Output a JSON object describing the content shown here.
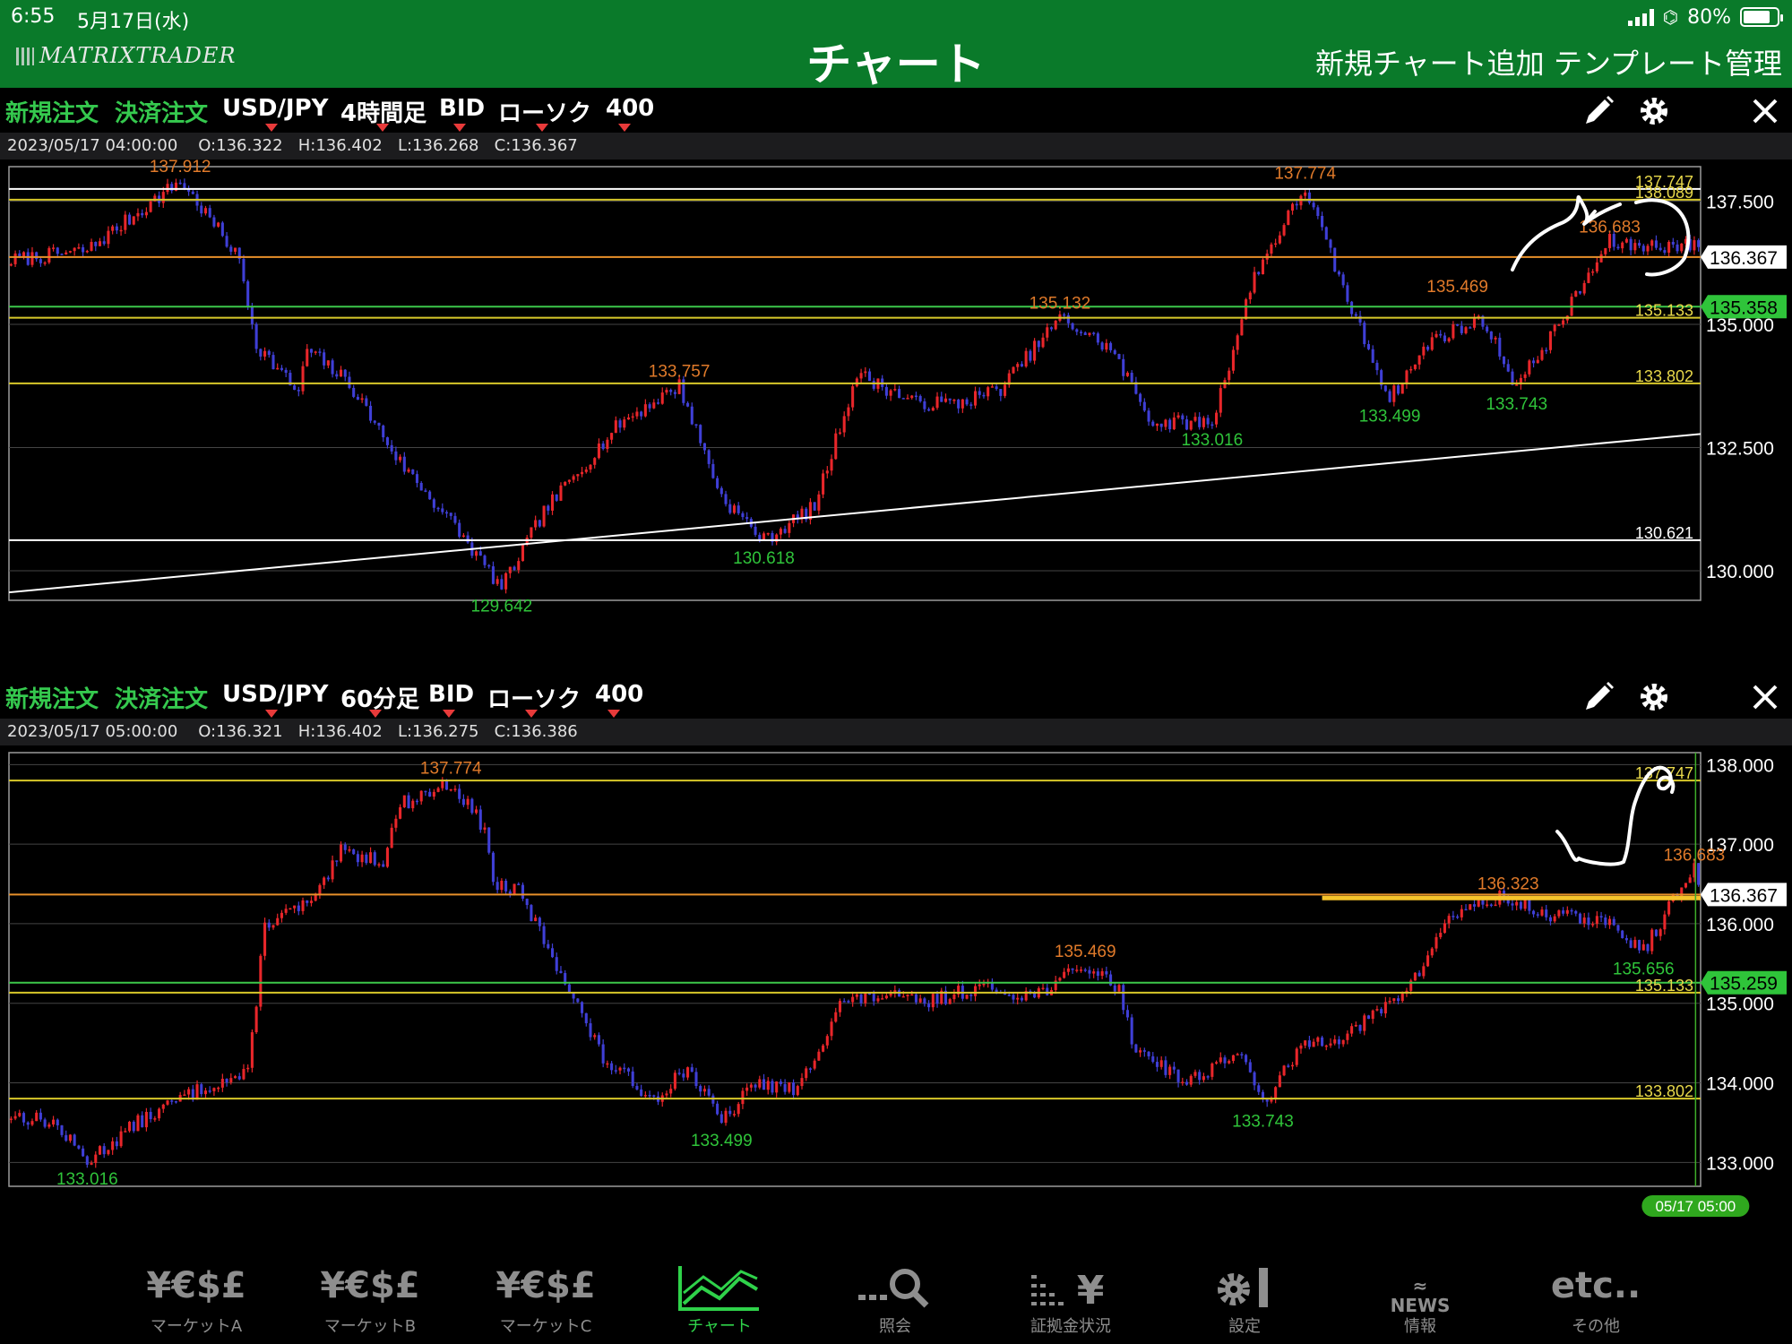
{
  "status": {
    "time": "6:55",
    "date": "5月17日(水)",
    "battery": "80%",
    "battery_level": 0.8
  },
  "header": {
    "logo": "MATRIXTRADER",
    "title": "チャート",
    "add_chart": "新規チャート追加",
    "template_mgmt": "テンプレート管理"
  },
  "colors": {
    "header_green": "#0a7a2a",
    "bull": "#e8262a",
    "bear": "#3f3fd6",
    "tab_active": "#2fd24a",
    "line_yellow": "#d8c82a",
    "line_orange": "#e8902a",
    "line_green": "#3cc84a",
    "label_orange": "#e07a2a",
    "label_green": "#2fc43a"
  },
  "panels": [
    {
      "toolbar": {
        "new_order": "新規注文",
        "close_order": "決済注文",
        "symbol": "USD/JPY",
        "timeframe": "4時間足",
        "price_type": "BID",
        "chart_type": "ローソク",
        "bars": "400"
      },
      "ohlc": {
        "datetime": "2023/05/17 04:00:00",
        "open": "O:136.322",
        "high": "H:136.402",
        "low": "L:136.268",
        "close": "C:136.367"
      },
      "chart_data": {
        "type": "candlestick",
        "ylim": [
          129.4,
          138.2
        ],
        "yticks": [
          "137.500",
          "135.000",
          "132.500",
          "130.000"
        ],
        "ytick_values": [
          137.5,
          135.0,
          132.5,
          130.0
        ],
        "path": [
          [
            0,
            136.3
          ],
          [
            18,
            136.5
          ],
          [
            40,
            137.912
          ],
          [
            50,
            136.8
          ],
          [
            54,
            136.3
          ],
          [
            58,
            134.6
          ],
          [
            68,
            133.6
          ],
          [
            70,
            134.5
          ],
          [
            80,
            133.8
          ],
          [
            92,
            132.2
          ],
          [
            104,
            131.0
          ],
          [
            116,
            129.642
          ],
          [
            126,
            131.2
          ],
          [
            136,
            132.2
          ],
          [
            144,
            133.0
          ],
          [
            158,
            133.757
          ],
          [
            168,
            131.5
          ],
          [
            178,
            130.618
          ],
          [
            190,
            131.3
          ],
          [
            200,
            134.0
          ],
          [
            214,
            133.4
          ],
          [
            224,
            133.4
          ],
          [
            234,
            133.7
          ],
          [
            248,
            135.132
          ],
          [
            260,
            134.5
          ],
          [
            270,
            133.0
          ],
          [
            284,
            133.016
          ],
          [
            294,
            136.0
          ],
          [
            306,
            137.774
          ],
          [
            316,
            135.5
          ],
          [
            326,
            133.499
          ],
          [
            336,
            134.7
          ],
          [
            348,
            135.1
          ],
          [
            356,
            133.743
          ],
          [
            366,
            135.0
          ],
          [
            378,
            136.683
          ],
          [
            381,
            136.6
          ]
        ],
        "hlines": [
          {
            "value": 137.747,
            "color": "#ffffff",
            "label": "137.747",
            "label_color": "#e8d84a"
          },
          {
            "value": 137.53,
            "color": "#d8c82a",
            "label": "138.089",
            "label_color": "#e8d84a"
          },
          {
            "value": 136.367,
            "color": "#e8902a",
            "label": "",
            "label_color": "#e8d84a"
          },
          {
            "value": 135.358,
            "color": "#3cc84a",
            "label": "",
            "label_color": "#e8d84a"
          },
          {
            "value": 135.133,
            "color": "#d8c82a",
            "label": "135.133",
            "label_color": "#e8d84a"
          },
          {
            "value": 133.802,
            "color": "#d8c82a",
            "label": "133.802",
            "label_color": "#e8d84a"
          },
          {
            "value": 130.621,
            "color": "#ffffff",
            "label": "130.621",
            "label_color": "#ffffff"
          }
        ],
        "trendline": {
          "from": [
            -18,
            129.42
          ],
          "to": [
            400,
            132.78
          ]
        },
        "peak_labels": [
          {
            "i": 40,
            "v": 137.912,
            "text": "137.912",
            "kind": "high"
          },
          {
            "i": 158,
            "v": 133.757,
            "text": "133.757",
            "kind": "high"
          },
          {
            "i": 248,
            "v": 135.132,
            "text": "135.132",
            "kind": "high"
          },
          {
            "i": 306,
            "v": 137.774,
            "text": "137.774",
            "kind": "high"
          },
          {
            "i": 342,
            "v": 135.469,
            "text": "135.469",
            "kind": "high"
          },
          {
            "i": 378,
            "v": 136.683,
            "text": "136.683",
            "kind": "high"
          },
          {
            "i": 116,
            "v": 129.642,
            "text": "129.642",
            "kind": "low"
          },
          {
            "i": 178,
            "v": 130.618,
            "text": "130.618",
            "kind": "low"
          },
          {
            "i": 284,
            "v": 133.016,
            "text": "133.016",
            "kind": "low"
          },
          {
            "i": 326,
            "v": 133.499,
            "text": "133.499",
            "kind": "low"
          },
          {
            "i": 356,
            "v": 133.743,
            "text": "133.743",
            "kind": "low"
          }
        ],
        "price_tags": [
          {
            "value": 136.367,
            "text": "136.367",
            "bg": "#ffffff",
            "fg": "#000000"
          },
          {
            "value": 135.358,
            "text": "135.358",
            "bg": "#2fc43a",
            "fg": "#000000"
          }
        ]
      }
    },
    {
      "toolbar": {
        "new_order": "新規注文",
        "close_order": "決済注文",
        "symbol": "USD/JPY",
        "timeframe": "60分足",
        "price_type": "BID",
        "chart_type": "ローソク",
        "bars": "400"
      },
      "ohlc": {
        "datetime": "2023/05/17 05:00:00",
        "open": "O:136.321",
        "high": "H:136.402",
        "low": "L:136.275",
        "close": "C:136.386"
      },
      "chart_data": {
        "type": "candlestick",
        "ylim": [
          132.7,
          138.15
        ],
        "yticks": [
          "138.000",
          "137.000",
          "136.000",
          "135.000",
          "134.000",
          "133.000"
        ],
        "ytick_values": [
          138.0,
          137.0,
          136.0,
          135.0,
          134.0,
          133.0
        ],
        "path": [
          [
            0,
            133.6
          ],
          [
            10,
            133.5
          ],
          [
            18,
            133.016
          ],
          [
            30,
            133.5
          ],
          [
            40,
            133.8
          ],
          [
            48,
            134.0
          ],
          [
            56,
            134.1
          ],
          [
            60,
            136.0
          ],
          [
            72,
            136.3
          ],
          [
            78,
            136.9
          ],
          [
            88,
            136.8
          ],
          [
            92,
            137.5
          ],
          [
            104,
            137.774
          ],
          [
            112,
            137.2
          ],
          [
            114,
            136.5
          ],
          [
            120,
            136.4
          ],
          [
            130,
            135.4
          ],
          [
            140,
            134.3
          ],
          [
            152,
            133.8
          ],
          [
            160,
            134.2
          ],
          [
            168,
            133.499
          ],
          [
            176,
            134.0
          ],
          [
            186,
            133.9
          ],
          [
            196,
            135.0
          ],
          [
            206,
            135.1
          ],
          [
            216,
            135.0
          ],
          [
            228,
            135.2
          ],
          [
            242,
            135.1
          ],
          [
            254,
            135.469
          ],
          [
            262,
            135.2
          ],
          [
            265,
            134.5
          ],
          [
            278,
            134.0
          ],
          [
            290,
            134.4
          ],
          [
            296,
            133.743
          ],
          [
            306,
            134.5
          ],
          [
            316,
            134.6
          ],
          [
            326,
            135.0
          ],
          [
            332,
            135.3
          ],
          [
            340,
            136.1
          ],
          [
            352,
            136.323
          ],
          [
            364,
            136.1
          ],
          [
            376,
            136.05
          ],
          [
            386,
            135.656
          ],
          [
            392,
            136.2
          ],
          [
            398,
            136.683
          ],
          [
            400,
            136.4
          ]
        ],
        "hlines": [
          {
            "value": 137.8,
            "color": "#d8c82a",
            "label": "137.747",
            "label_color": "#e8d84a"
          },
          {
            "value": 136.367,
            "color": "#e8902a",
            "label": "",
            "label_color": "#e8d84a"
          },
          {
            "value": 135.259,
            "color": "#3cc84a",
            "label": "",
            "label_color": "#e8d84a"
          },
          {
            "value": 135.133,
            "color": "#d8c82a",
            "label": "135.133",
            "label_color": "#e8d84a"
          },
          {
            "value": 133.802,
            "color": "#d8c82a",
            "label": "133.802",
            "label_color": "#e8d84a"
          }
        ],
        "extra_line": {
          "value": 136.323,
          "from_i": 310,
          "color": "#f5c32a",
          "width": 5
        },
        "cursor": {
          "i": 400,
          "label": "05/17 05:00"
        },
        "peak_labels": [
          {
            "i": 104,
            "v": 137.774,
            "text": "137.774",
            "kind": "high"
          },
          {
            "i": 254,
            "v": 135.469,
            "text": "135.469",
            "kind": "high"
          },
          {
            "i": 354,
            "v": 136.323,
            "text": "136.323",
            "kind": "high"
          },
          {
            "i": 398,
            "v": 136.683,
            "text": "136.683",
            "kind": "high"
          },
          {
            "i": 18,
            "v": 133.016,
            "text": "133.016",
            "kind": "low"
          },
          {
            "i": 168,
            "v": 133.499,
            "text": "133.499",
            "kind": "low"
          },
          {
            "i": 296,
            "v": 133.743,
            "text": "133.743",
            "kind": "low"
          },
          {
            "i": 386,
            "v": 135.656,
            "text": "135.656",
            "kind": "low"
          }
        ],
        "price_tags": [
          {
            "value": 136.367,
            "text": "136.367",
            "bg": "#ffffff",
            "fg": "#000000"
          },
          {
            "value": 135.259,
            "text": "135.259",
            "bg": "#2fc43a",
            "fg": "#000000"
          }
        ]
      }
    }
  ],
  "tabs": [
    {
      "name": "tab-market-a",
      "icon": "¥€$£",
      "label": "マーケットA",
      "active": false
    },
    {
      "name": "tab-market-b",
      "icon": "¥€$£",
      "label": "マーケットB",
      "active": false
    },
    {
      "name": "tab-market-c",
      "icon": "¥€$£",
      "label": "マーケットC",
      "active": false
    },
    {
      "name": "tab-chart",
      "icon": "chart-icon",
      "label": "チャート",
      "active": true
    },
    {
      "name": "tab-inquiry",
      "icon": "search-icon",
      "label": "照会",
      "active": false
    },
    {
      "name": "tab-margin",
      "icon": "margin-icon",
      "label": "証拠金状況",
      "active": false
    },
    {
      "name": "tab-settings",
      "icon": "settings-icon",
      "label": "設定",
      "active": false
    },
    {
      "name": "tab-news",
      "icon": "NEWS",
      "label": "情報",
      "active": false
    },
    {
      "name": "tab-etc",
      "icon": "etc..",
      "label": "その他",
      "active": false
    }
  ]
}
